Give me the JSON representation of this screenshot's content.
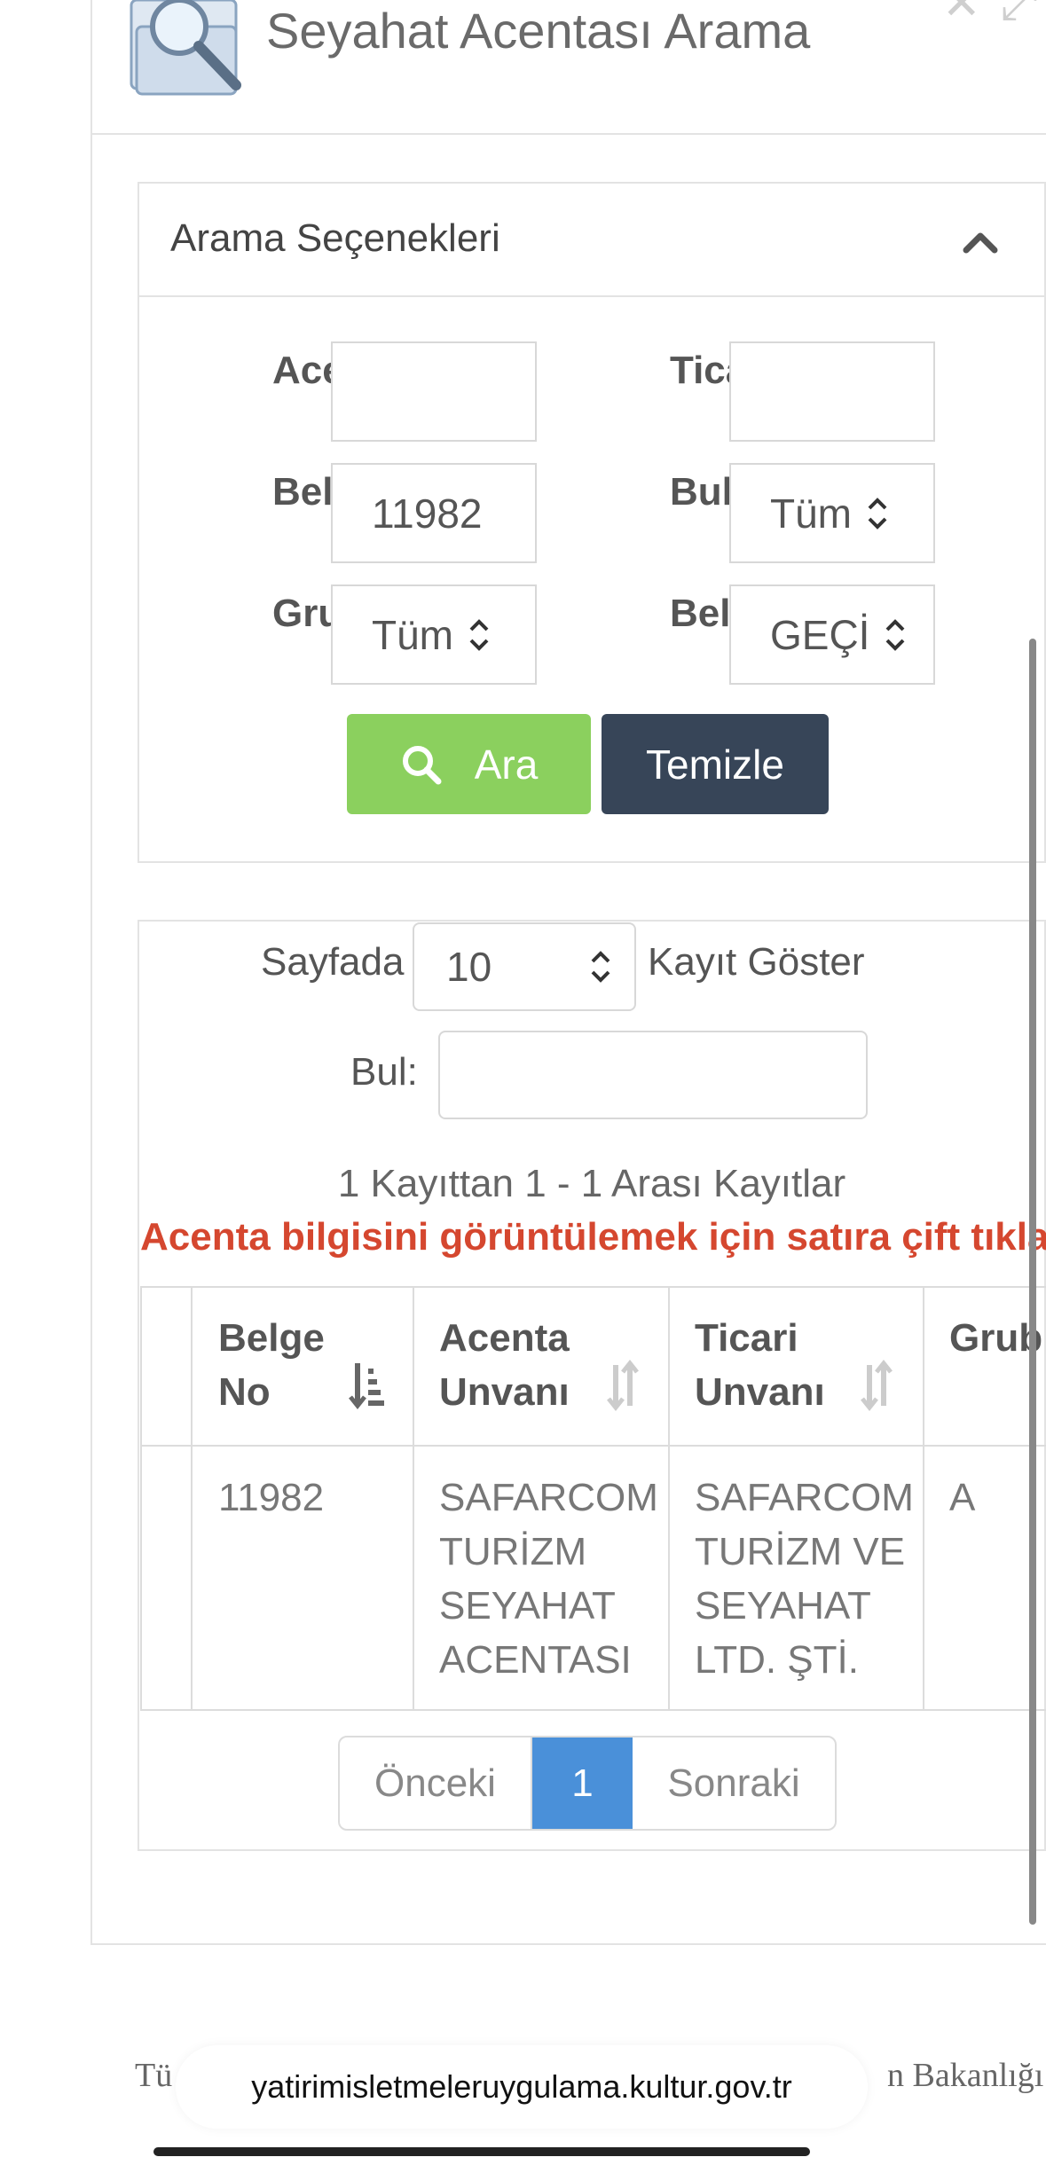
{
  "window": {
    "title": "Seyahat Acentası Arama"
  },
  "search_options": {
    "title": "Arama Seçenekleri",
    "fields": {
      "acente_unvani": {
        "label": "Acente Unvanı",
        "value": ""
      },
      "ticari_unvani": {
        "label": "Ticari Unvanı",
        "value": ""
      },
      "belge_no": {
        "label": "Belge Numarası",
        "value": "11982"
      },
      "bulundugu_il": {
        "label": "Bulunduğu İl",
        "value": "Tüm"
      },
      "grup": {
        "label": "Grup",
        "value": "Tüm"
      },
      "belge_durumu": {
        "label": "Belge Durumu",
        "value": "GEÇİ"
      }
    },
    "search_button": "Ara",
    "clear_button": "Temizle"
  },
  "results": {
    "page_size_prefix": "Sayfada",
    "page_size_value": "10",
    "page_size_suffix": "Kayıt Göster",
    "find_label": "Bul:",
    "find_value": "",
    "info_text": "1 Kayıttan 1 - 1 Arası Kayıtlar",
    "hint_text": "Acenta bilgisini görüntülemek için satıra çift tıklayınız",
    "columns": [
      "Belge\nNo",
      "Acenta\nUnvanı",
      "Ticari\nUnvanı",
      "Grub"
    ],
    "rows": [
      {
        "belge_no": "11982",
        "acenta_unvani": "SAFARCOM\nTURİZM\nSEYAHAT\nACENTASI",
        "ticari_unvani": "SAFARCOM\nTURİZM VE\nSEYAHAT\nLTD. ŞTİ.",
        "grup": "A"
      }
    ],
    "pagination": {
      "prev": "Önceki",
      "current": "1",
      "next": "Sonraki"
    }
  },
  "footer": {
    "left": "Tü",
    "right": "n Bakanlığı"
  },
  "browser": {
    "url": "yatirimisletmeleruygulama.kultur.gov.tr"
  }
}
